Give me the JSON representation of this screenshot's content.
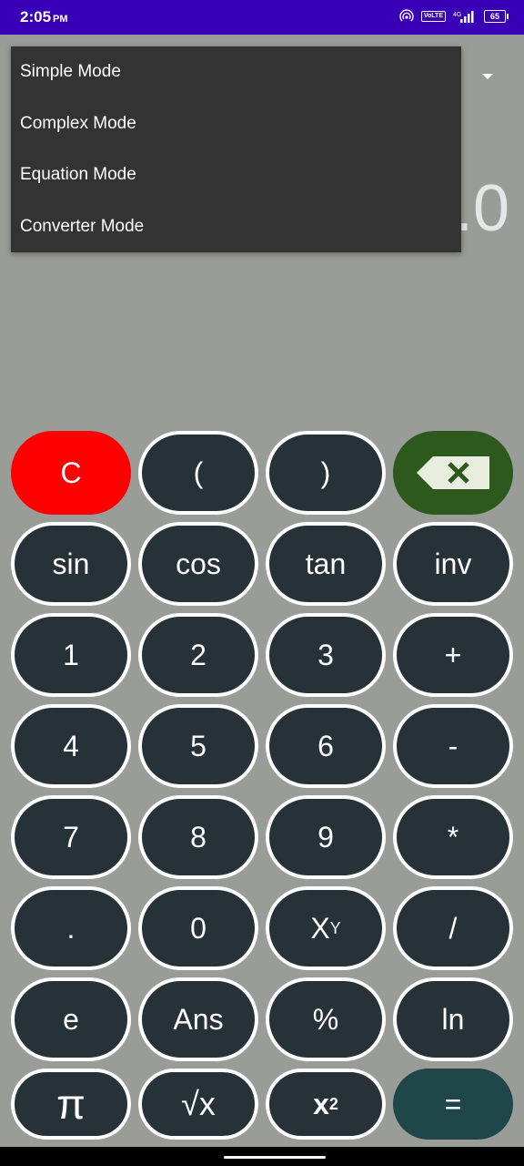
{
  "status_bar": {
    "time": "2:05",
    "ampm": "PM",
    "network_badge": "VoLTE",
    "battery": "65"
  },
  "display": {
    "result": ".0"
  },
  "mode_menu": {
    "items": [
      "Simple Mode",
      "Complex Mode",
      "Equation Mode",
      "Converter Mode"
    ]
  },
  "keypad": {
    "rows": [
      [
        "C",
        "(",
        ")",
        "backspace"
      ],
      [
        "sin",
        "cos",
        "tan",
        "inv"
      ],
      [
        "1",
        "2",
        "3",
        "+"
      ],
      [
        "4",
        "5",
        "6",
        "-"
      ],
      [
        "7",
        "8",
        "9",
        "*"
      ],
      [
        ".",
        "0",
        "XY",
        "/"
      ],
      [
        "e",
        "Ans",
        "%",
        "ln"
      ],
      [
        "π",
        "√x",
        "x²",
        "="
      ]
    ],
    "labels": {
      "clear": "C",
      "open_paren": "(",
      "close_paren": ")",
      "sin": "sin",
      "cos": "cos",
      "tan": "tan",
      "inv": "inv",
      "one": "1",
      "two": "2",
      "three": "3",
      "plus": "+",
      "four": "4",
      "five": "5",
      "six": "6",
      "minus": "-",
      "seven": "7",
      "eight": "8",
      "nine": "9",
      "multiply": "*",
      "dot": ".",
      "zero": "0",
      "power_base": "X",
      "power_sup": "Y",
      "divide": "/",
      "e": "e",
      "ans": "Ans",
      "percent": "%",
      "ln": "ln",
      "pi": "π",
      "sqrt": "√x",
      "square_base": "x",
      "square_sup": "2",
      "equals": "="
    }
  },
  "colors": {
    "background": "#9a9c98",
    "status_bar": "#3a00b8",
    "key": "#263238",
    "clear": "#ff0000",
    "backspace": "#2d5a1c",
    "equals": "#1f4648",
    "menu": "#333333"
  }
}
